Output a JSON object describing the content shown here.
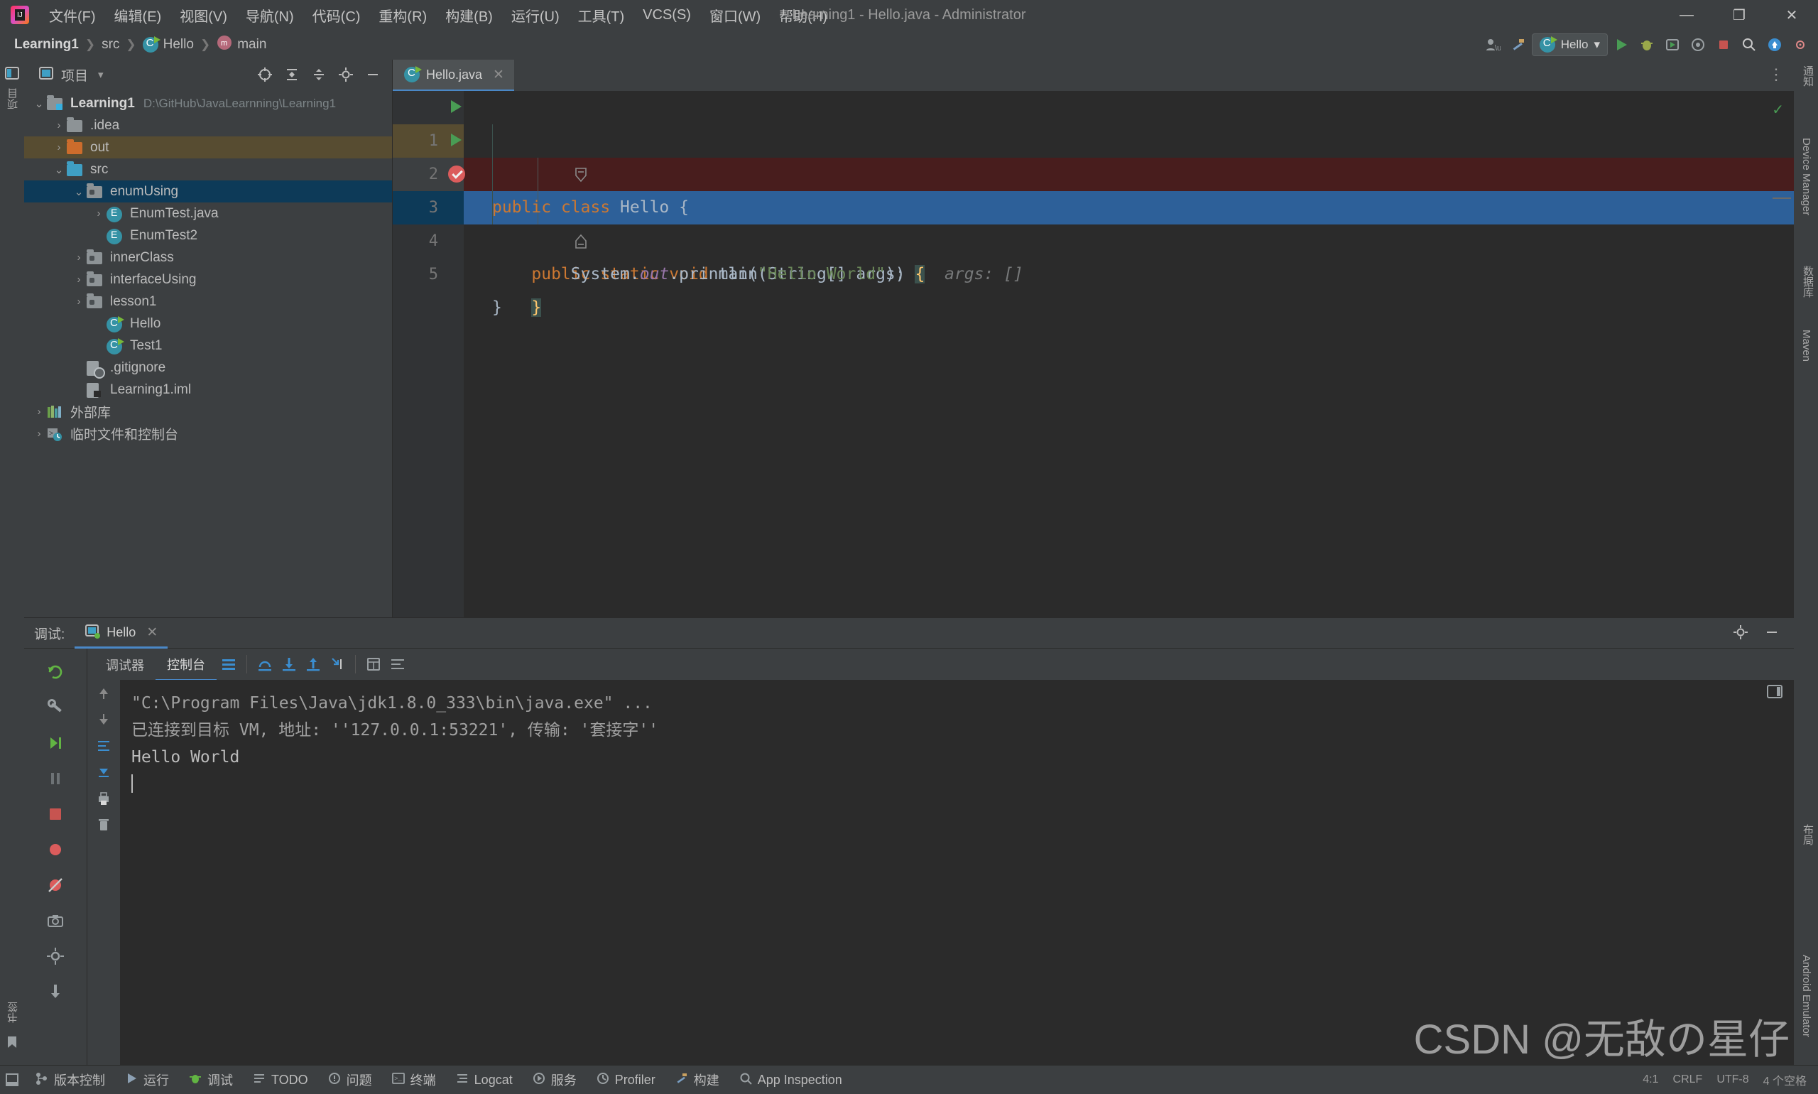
{
  "window": {
    "title": "Learning1 - Hello.java - Administrator",
    "minimize": "—",
    "maximize": "❐",
    "close": "✕"
  },
  "menubar": {
    "items": [
      {
        "label": "文件(F)"
      },
      {
        "label": "编辑(E)"
      },
      {
        "label": "视图(V)"
      },
      {
        "label": "导航(N)"
      },
      {
        "label": "代码(C)"
      },
      {
        "label": "重构(R)"
      },
      {
        "label": "构建(B)"
      },
      {
        "label": "运行(U)"
      },
      {
        "label": "工具(T)"
      },
      {
        "label": "VCS(S)"
      },
      {
        "label": "窗口(W)"
      },
      {
        "label": "帮助(H)"
      }
    ]
  },
  "navbar": {
    "crumbs": [
      {
        "label": "Learning1",
        "icon": "none",
        "bold": true
      },
      {
        "label": "src",
        "icon": "none",
        "bold": false
      },
      {
        "label": "Hello",
        "icon": "class-icon",
        "bold": false
      },
      {
        "label": "main",
        "icon": "method-icon",
        "bold": false
      }
    ],
    "separator": "❯",
    "run_config": "Hello",
    "run_config_chevron": "▾",
    "icons": [
      "user-settings-icon",
      "build-hammer-icon",
      "run-icon",
      "debug-icon",
      "run-coverage-icon",
      "profiler-icon",
      "stop-icon",
      "search-icon",
      "updates-icon",
      "settings-gear-icon"
    ]
  },
  "left_stripe": {
    "top_label": "项目",
    "bottom_labels": [
      "书签"
    ]
  },
  "right_stripe": {
    "labels": [
      "通知",
      "Device Manager",
      "数据库",
      "Maven",
      "布局",
      "Android Emulator"
    ]
  },
  "project_panel": {
    "title": "项目",
    "dropdown": "▾",
    "toolbar_icons": [
      "locate-icon",
      "expand-all-icon",
      "collapse-all-icon",
      "settings-gear-icon",
      "hide-icon"
    ],
    "tree": [
      {
        "depth": 0,
        "arrow": "⌄",
        "icon": "module-folder-icon",
        "label": "Learning1",
        "bold": true,
        "path": "D:\\GitHub\\JavaLearnning\\Learning1",
        "state": "normal"
      },
      {
        "depth": 1,
        "arrow": "›",
        "icon": "folder-gray-icon",
        "label": ".idea",
        "bold": false,
        "path": "",
        "state": "normal"
      },
      {
        "depth": 1,
        "arrow": "›",
        "icon": "folder-orange-icon",
        "label": "out",
        "bold": false,
        "path": "",
        "state": "excluded"
      },
      {
        "depth": 1,
        "arrow": "⌄",
        "icon": "folder-blue-icon",
        "label": "src",
        "bold": false,
        "path": "",
        "state": "normal"
      },
      {
        "depth": 2,
        "arrow": "⌄",
        "icon": "package-icon",
        "label": "enumUsing",
        "bold": false,
        "path": "",
        "state": "selected"
      },
      {
        "depth": 3,
        "arrow": "›",
        "icon": "enum-icon",
        "label": "EnumTest.java",
        "bold": false,
        "path": "",
        "state": "normal"
      },
      {
        "depth": 3,
        "arrow": "",
        "icon": "enum-icon",
        "label": "EnumTest2",
        "bold": false,
        "path": "",
        "state": "normal"
      },
      {
        "depth": 2,
        "arrow": "›",
        "icon": "package-icon",
        "label": "innerClass",
        "bold": false,
        "path": "",
        "state": "normal"
      },
      {
        "depth": 2,
        "arrow": "›",
        "icon": "package-icon",
        "label": "interfaceUsing",
        "bold": false,
        "path": "",
        "state": "normal"
      },
      {
        "depth": 2,
        "arrow": "›",
        "icon": "package-icon",
        "label": "lesson1",
        "bold": false,
        "path": "",
        "state": "normal"
      },
      {
        "depth": 3,
        "arrow": "",
        "icon": "class-runnable-icon",
        "label": "Hello",
        "bold": false,
        "path": "",
        "state": "normal"
      },
      {
        "depth": 3,
        "arrow": "",
        "icon": "class-runnable-icon",
        "label": "Test1",
        "bold": false,
        "path": "",
        "state": "normal"
      },
      {
        "depth": 2,
        "arrow": "",
        "icon": "gitignore-file-icon",
        "label": ".gitignore",
        "bold": false,
        "path": "",
        "state": "normal"
      },
      {
        "depth": 2,
        "arrow": "",
        "icon": "iml-file-icon",
        "label": "Learning1.iml",
        "bold": false,
        "path": "",
        "state": "normal"
      },
      {
        "depth": 0,
        "arrow": "›",
        "icon": "external-libraries-icon",
        "label": "外部库",
        "bold": false,
        "path": "",
        "state": "normal"
      },
      {
        "depth": 0,
        "arrow": "›",
        "icon": "scratches-icon",
        "label": "临时文件和控制台",
        "bold": false,
        "path": "",
        "state": "normal"
      }
    ]
  },
  "editor": {
    "tab": {
      "label": "Hello.java",
      "icon": "class-runnable-icon",
      "close": "✕"
    },
    "inspection_status": "✓",
    "more_icon": "⋮",
    "lines": [
      {
        "num": "1",
        "gutter": "run",
        "segments": [
          {
            "t": "public ",
            "c": "kw"
          },
          {
            "t": "class ",
            "c": "kw"
          },
          {
            "t": "Hello ",
            "c": "cls"
          },
          {
            "t": "{",
            "c": "pln"
          }
        ]
      },
      {
        "num": "2",
        "gutter": "run",
        "fold": "⊖",
        "segments": [
          {
            "t": "    ",
            "c": "pln"
          },
          {
            "t": "public ",
            "c": "kw"
          },
          {
            "t": "static ",
            "c": "kw"
          },
          {
            "t": "void ",
            "c": "kw"
          },
          {
            "t": "main",
            "c": "cls"
          },
          {
            "t": "(String[] args) ",
            "c": "pln"
          },
          {
            "t": "{",
            "c": "brace"
          },
          {
            "t": "  args: []",
            "c": "hint"
          }
        ]
      },
      {
        "num": "3",
        "gutter": "breakpoint-hit",
        "segments": [
          {
            "t": "        ",
            "c": "pln"
          },
          {
            "t": "System.",
            "c": "cls"
          },
          {
            "t": "out",
            "c": "fld"
          },
          {
            "t": ".println(",
            "c": "cls"
          },
          {
            "t": "\"Hello World\"",
            "c": "str"
          },
          {
            "t": ");",
            "c": "pln"
          }
        ]
      },
      {
        "num": "4",
        "gutter": "fold-end",
        "segments": [
          {
            "t": "    ",
            "c": "pln"
          },
          {
            "t": "}",
            "c": "brace"
          }
        ]
      },
      {
        "num": "5",
        "gutter": "",
        "segments": [
          {
            "t": "}",
            "c": "pln"
          }
        ]
      }
    ]
  },
  "debug_panel": {
    "label": "调试:",
    "tab": {
      "label": "Hello",
      "close": "✕",
      "icon": "debug-session-icon"
    },
    "header_icons": [
      "settings-gear-icon",
      "hide-icon"
    ],
    "sidebar_icons": [
      "rerun-icon",
      "wrench-icon",
      "resume-icon",
      "pause-icon",
      "stop-icon",
      "mute-breakpoints-icon",
      "view-breakpoints-icon",
      "camera-icon",
      "settings-gear-icon",
      "pin-icon"
    ],
    "subtabs": [
      {
        "label": "调试器",
        "active": false
      },
      {
        "label": "控制台",
        "active": true
      }
    ],
    "step_icons": [
      "show-execution-point-icon",
      "step-over-icon",
      "step-into-icon",
      "step-out-icon",
      "run-to-cursor-icon",
      "evaluate-icon",
      "soft-wrap-icon"
    ],
    "console_rail_icons": [
      "up-arrow-icon",
      "down-arrow-icon",
      "soft-wrap-icon",
      "scroll-to-end-icon",
      "print-icon",
      "clear-all-icon"
    ],
    "console_lines": [
      {
        "text": "\"C:\\Program Files\\Java\\jdk1.8.0_333\\bin\\java.exe\" ...",
        "style": "sys"
      },
      {
        "text": "已连接到目标 VM, 地址: ''127.0.0.1:53221', 传输: '套接字''",
        "style": "sys"
      },
      {
        "text": "Hello World",
        "style": "out"
      }
    ],
    "layout_icon": "restore-layout-icon"
  },
  "statusbar": {
    "items": [
      {
        "label": "版本控制",
        "icon": "vcs-icon"
      },
      {
        "label": "运行",
        "icon": "run-icon"
      },
      {
        "label": "调试",
        "icon": "debug-icon"
      },
      {
        "label": "TODO",
        "icon": "todo-icon"
      },
      {
        "label": "问题",
        "icon": "problems-icon"
      },
      {
        "label": "终端",
        "icon": "terminal-icon"
      },
      {
        "label": "Logcat",
        "icon": "logcat-icon"
      },
      {
        "label": "服务",
        "icon": "services-icon"
      },
      {
        "label": "Profiler",
        "icon": "profiler-icon"
      },
      {
        "label": "构建",
        "icon": "build-icon"
      },
      {
        "label": "App Inspection",
        "icon": "app-inspection-icon"
      }
    ],
    "right": [
      "4:1",
      "CRLF",
      "UTF-8",
      "4 个空格"
    ]
  },
  "watermark": "CSDN @无敌の星仔",
  "colors": {
    "accent_blue": "#4a88c7",
    "selection": "#0d3a58",
    "keyword_orange": "#cc7832",
    "string_green": "#6a8759",
    "field_purple": "#9876aa",
    "breakpoint_red": "#db5c5c",
    "excluded_orange": "#cc6c2c"
  }
}
